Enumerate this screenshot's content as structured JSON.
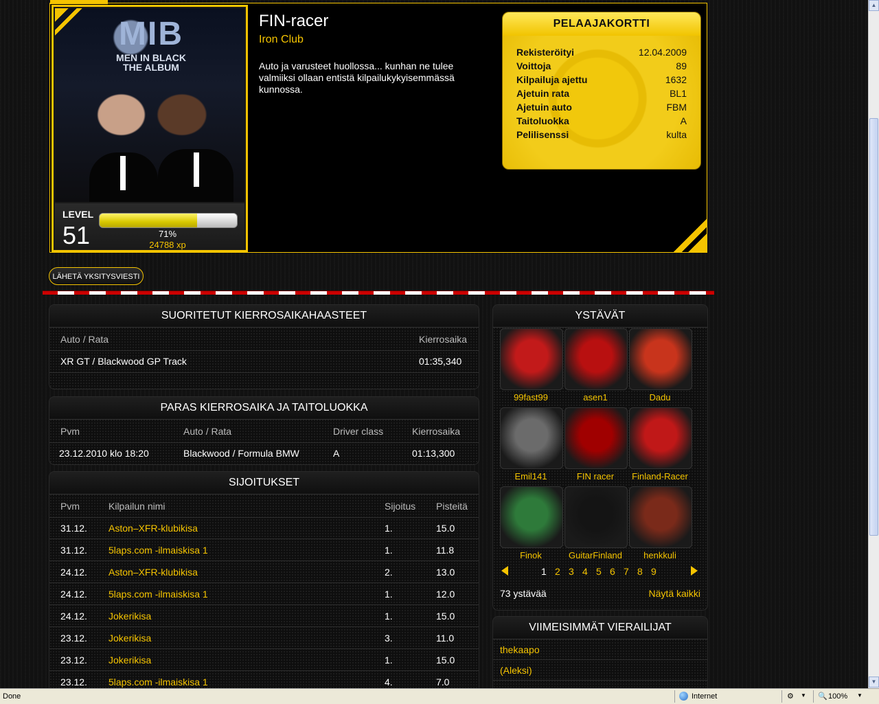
{
  "profile": {
    "name": "FIN-racer",
    "club": "Iron Club",
    "description": "Auto ja varusteet huollossa... kunhan ne tulee valmiiksi ollaan entistä kilpailukykyisemmässä kunnossa.",
    "avatar_text": {
      "title": "MIB",
      "line1": "MEN IN BLACK",
      "line2": "THE ALBUM"
    },
    "level_label": "LEVEL",
    "level": "51",
    "progress_fraction": 0.71,
    "progress_label": "71%",
    "xp": "24788 xp"
  },
  "player_card": {
    "title": "PELAAJAKORTTI",
    "rows": [
      {
        "key": "Rekisteröityi",
        "value": "12.04.2009"
      },
      {
        "key": "Voittoja",
        "value": "89"
      },
      {
        "key": "Kilpailuja ajettu",
        "value": "1632"
      },
      {
        "key": "Ajetuin rata",
        "value": "BL1"
      },
      {
        "key": "Ajetuin auto",
        "value": "FBM"
      },
      {
        "key": "Taitoluokka",
        "value": "A"
      },
      {
        "key": "Pelilisenssi",
        "value": "kulta"
      }
    ]
  },
  "actions": {
    "send_pm": "LÄHETÄ YKSITYSVIESTI"
  },
  "laptime_challenges": {
    "title": "SUORITETUT KIERROSAIKAHAASTEET",
    "headers": [
      "Auto / Rata",
      "Kierrosaika"
    ],
    "rows": [
      [
        "XR GT / Blackwood GP Track",
        "01:35,340"
      ]
    ]
  },
  "best_lap": {
    "title": "PARAS KIERROSAIKA JA TAITOLUOKKA",
    "headers": [
      "Pvm",
      "Auto / Rata",
      "Driver class",
      "Kierrosaika"
    ],
    "rows": [
      [
        "23.12.2010 klo 18:20",
        "Blackwood / Formula BMW",
        "A",
        "01:13,300"
      ]
    ]
  },
  "rankings": {
    "title": "SIJOITUKSET",
    "headers": [
      "Pvm",
      "Kilpailun nimi",
      "Sijoitus",
      "Pisteitä"
    ],
    "rows": [
      [
        "31.12.",
        "Aston–XFR-klubikisa",
        "1.",
        "15.0"
      ],
      [
        "31.12.",
        "5laps.com -ilmaiskisa 1",
        "1.",
        "11.8"
      ],
      [
        "24.12.",
        "Aston–XFR-klubikisa",
        "2.",
        "13.0"
      ],
      [
        "24.12.",
        "5laps.com -ilmaiskisa 1",
        "1.",
        "12.0"
      ],
      [
        "24.12.",
        "Jokerikisa",
        "1.",
        "15.0"
      ],
      [
        "23.12.",
        "Jokerikisa",
        "3.",
        "11.0"
      ],
      [
        "23.12.",
        "Jokerikisa",
        "1.",
        "15.0"
      ],
      [
        "23.12.",
        "5laps.com -ilmaiskisa 1",
        "4.",
        "7.0"
      ]
    ]
  },
  "friends": {
    "title": "YSTÄVÄT",
    "items": [
      {
        "name": "99fast99",
        "color": "#c21a1a"
      },
      {
        "name": "asen1",
        "color": "#b81010"
      },
      {
        "name": "Dadu",
        "color": "#c8341c"
      },
      {
        "name": "Emil141",
        "color": "#6b6b6b"
      },
      {
        "name": "FIN racer",
        "color": "#a00000"
      },
      {
        "name": "Finland-Racer",
        "color": "#c01818"
      },
      {
        "name": "Finok",
        "color": "#2e7a3a"
      },
      {
        "name": "GuitarFinland",
        "color": "#141414"
      },
      {
        "name": "henkkuli",
        "color": "#7a2a1a"
      }
    ],
    "pages": [
      "1",
      "2",
      "3",
      "4",
      "5",
      "6",
      "7",
      "8",
      "9"
    ],
    "count_label": "73 ystävää",
    "show_all": "Näytä kaikki"
  },
  "visitors": {
    "title": "VIIMEISIMMÄT VIERAILIJAT",
    "items": [
      "thekaapo",
      "(Aleksi)"
    ]
  },
  "statusbar": {
    "left": "Done",
    "zone": "Internet",
    "zoom": "100%"
  },
  "colors": {
    "accent": "#f5c400",
    "divider_red": "#cc0000"
  }
}
